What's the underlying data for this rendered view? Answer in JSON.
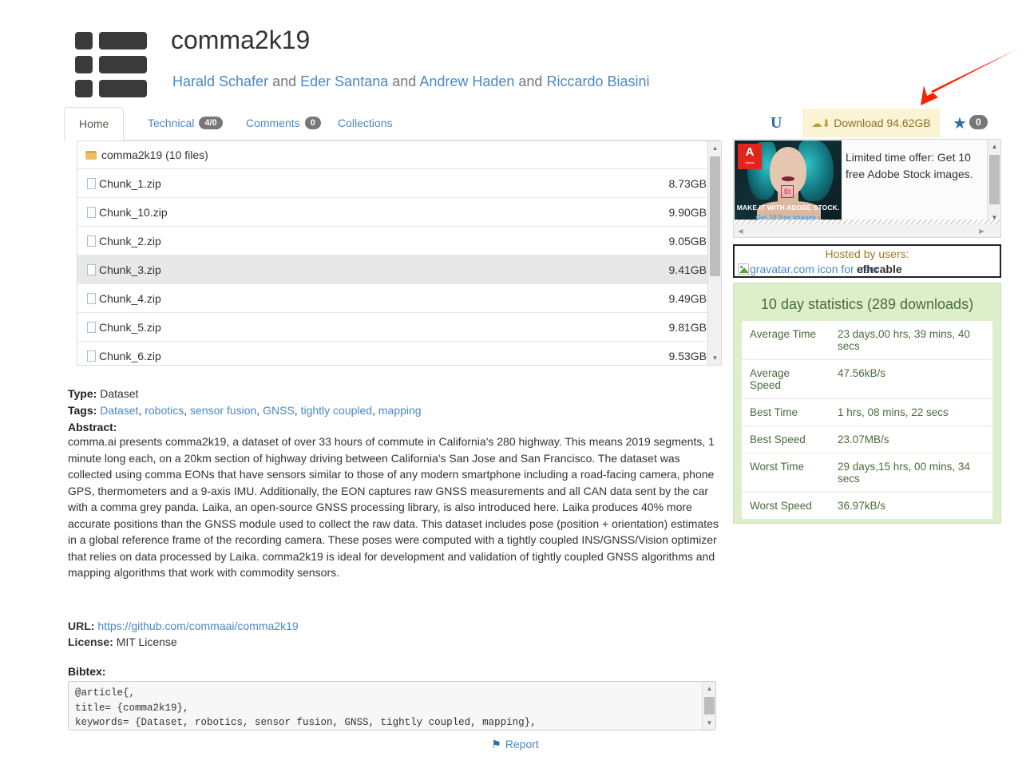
{
  "header": {
    "title": "comma2k19",
    "authors": [
      {
        "name": "Harald Schafer",
        "type": "link"
      },
      {
        "name": "and",
        "type": "text"
      },
      {
        "name": "Eder Santana",
        "type": "link"
      },
      {
        "name": "and",
        "type": "text"
      },
      {
        "name": "Andrew Haden",
        "type": "link"
      },
      {
        "name": "and",
        "type": "text"
      },
      {
        "name": "Riccardo Biasini",
        "type": "link"
      }
    ],
    "logo_icon": "grid-list-logo-icon"
  },
  "tabs": [
    {
      "label": "Home",
      "badge": null,
      "active": true
    },
    {
      "label": "Technical",
      "badge": "4/0",
      "active": false
    },
    {
      "label": "Comments",
      "badge": "0",
      "active": false
    },
    {
      "label": "Collections",
      "badge": null,
      "active": false
    }
  ],
  "toolbar": {
    "u_icon_label": "U",
    "download_label": "Download 94.62GB",
    "download_icon": "cloud-download-icon",
    "star_icon": "star-icon",
    "star_count": "0",
    "arrow_annotation": "red-arrow-pointing-to-download"
  },
  "files": {
    "root_label": "comma2k19 (10 files)",
    "folder_icon": "folder-icon",
    "items": [
      {
        "name": "Chunk_1.zip",
        "size": "8.73GB",
        "selected": false
      },
      {
        "name": "Chunk_10.zip",
        "size": "9.90GB",
        "selected": false
      },
      {
        "name": "Chunk_2.zip",
        "size": "9.05GB",
        "selected": false
      },
      {
        "name": "Chunk_3.zip",
        "size": "9.41GB",
        "selected": true
      },
      {
        "name": "Chunk_4.zip",
        "size": "9.49GB",
        "selected": false
      },
      {
        "name": "Chunk_5.zip",
        "size": "9.81GB",
        "selected": false
      },
      {
        "name": "Chunk_6.zip",
        "size": "9.53GB",
        "selected": false
      }
    ]
  },
  "meta": {
    "type_label": "Type:",
    "type_value": "Dataset",
    "tags_label": "Tags:",
    "tags": [
      "Dataset",
      "robotics",
      "sensor fusion",
      "GNSS",
      "tightly coupled",
      "mapping"
    ],
    "abstract_label": "Abstract:",
    "abstract": "comma.ai presents comma2k19, a dataset of over 33 hours of commute in California's 280 highway. This means 2019 segments, 1 minute long each, on a 20km section of highway driving between California's San Jose and San Francisco. The dataset was collected using comma EONs that have sensors similar to those of any modern smartphone including a road-facing camera, phone GPS, thermometers and a 9-axis IMU. Additionally, the EON captures raw GNSS measurements and all CAN data sent by the car with a comma grey panda. Laika, an open-source GNSS processing library, is also introduced here. Laika produces 40% more accurate positions than the GNSS module used to collect the raw data. This dataset includes pose (position + orientation) estimates in a global reference frame of the recording camera. These poses were computed with a tightly coupled INS/GNSS/Vision optimizer that relies on data processed by Laika. comma2k19 is ideal for development and validation of tightly coupled GNSS algorithms and mapping algorithms that work with commodity sensors.",
    "url_label": "URL:",
    "url_value": "https://github.com/commaai/comma2k19",
    "license_label": "License:",
    "license_value": "MIT License",
    "bibtex_label": "Bibtex:",
    "bibtex": "@article{,\ntitle= {comma2k19},\nkeywords= {Dataset, robotics, sensor fusion, GNSS, tightly coupled, mapping},"
  },
  "footer": {
    "report_label": "Report",
    "report_icon": "flag-icon"
  },
  "ad": {
    "text": "Limited time offer: Get 10 free Adobe Stock images.",
    "brand": "Adobe",
    "badge": "St",
    "caption_line1": "MAKE IT WITH ADOBE STOCK.",
    "caption_line2": "Get 10 free images ›"
  },
  "hosted": {
    "title": "Hosted by users:",
    "broken_image_alt": "gravatar.com icon for user",
    "username": "efhcable"
  },
  "stats": {
    "title": "10 day statistics (289 downloads)",
    "rows": [
      {
        "key": "Average Time",
        "value": "23 days,00 hrs, 39 mins, 40 secs"
      },
      {
        "key": "Average Speed",
        "value": "47.56kB/s"
      },
      {
        "key": "Best Time",
        "value": "1 hrs, 08 mins, 22 secs"
      },
      {
        "key": "Best Speed",
        "value": "23.07MB/s"
      },
      {
        "key": "Worst Time",
        "value": "29 days,15 hrs, 00 mins, 34 secs"
      },
      {
        "key": "Worst Speed",
        "value": "36.97kB/s"
      }
    ]
  },
  "colors": {
    "link": "#4b88c6",
    "download_bg": "#faf3d4",
    "download_text": "#8a7528",
    "stats_bg": "#ddeecb",
    "stats_text": "#4c6b3c",
    "badge_bg": "#777777",
    "arrow": "#f92200",
    "selected_row": "#e8e8e8"
  }
}
